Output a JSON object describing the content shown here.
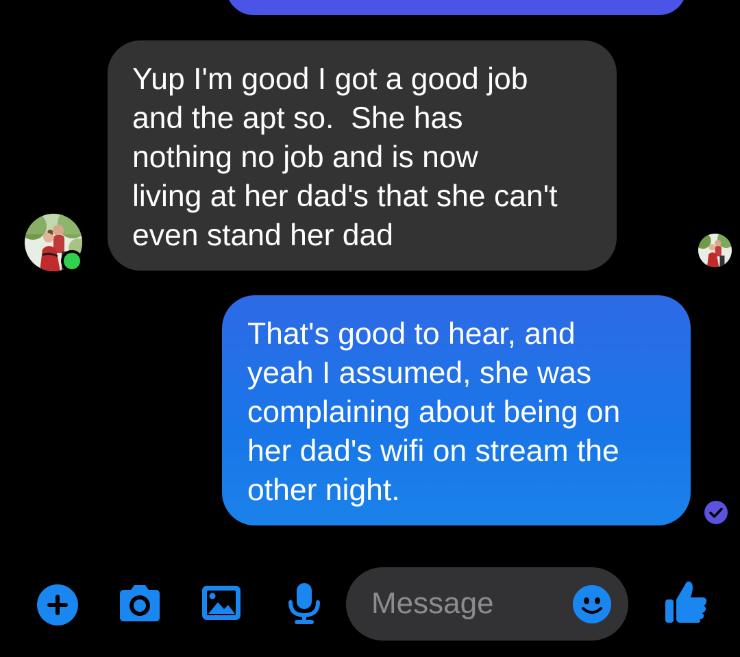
{
  "conversation": {
    "messages": [
      {
        "direction": "incoming",
        "lines": [
          "Yup I'm good I got a good job",
          "and the apt so.  She has",
          "nothing no job and is now",
          "living at her dad's that she can't",
          "even stand her dad"
        ]
      },
      {
        "direction": "outgoing",
        "lines": [
          "That's good to hear, and",
          "yeah I assumed, she was",
          "complaining about being on",
          "her dad's wifi on stream the",
          "other night."
        ]
      }
    ],
    "contact_status": "online"
  },
  "composer": {
    "placeholder": "Message",
    "icons": [
      "plus-icon",
      "camera-icon",
      "gallery-icon",
      "microphone-icon",
      "emoji-icon",
      "thumbs-up-icon"
    ]
  },
  "colors": {
    "background": "#000000",
    "incoming_bubble": "#333334",
    "outgoing_bubble": "#1a76e8",
    "accent": "#1a86f0",
    "seen_indicator": "#5b52e0",
    "online": "#31d14e"
  }
}
